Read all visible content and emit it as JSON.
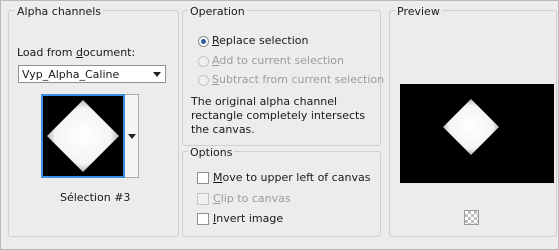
{
  "alpha_channels": {
    "title": "Alpha channels",
    "load_from_label_pre": "Load from ",
    "load_from_label_u": "d",
    "load_from_label_post": "ocument:",
    "document_value": "Vyp_Alpha_Caline",
    "selection_label": "Sélection #3"
  },
  "operation": {
    "title": "Operation",
    "options": [
      {
        "u": "R",
        "rest": "eplace selection",
        "selected": true,
        "enabled": true
      },
      {
        "u": "A",
        "rest": "dd to current selection",
        "selected": false,
        "enabled": false
      },
      {
        "u": "S",
        "rest": "ubtract from current selection",
        "selected": false,
        "enabled": false
      }
    ],
    "description": "The original alpha channel rectangle completely intersects the canvas."
  },
  "options": {
    "title": "Options",
    "items": [
      {
        "u": "M",
        "rest": "ove to upper left of canvas",
        "checked": false,
        "enabled": true
      },
      {
        "u": "C",
        "rest": "lip to canvas",
        "checked": false,
        "enabled": false
      },
      {
        "u": "I",
        "rest": "nvert image",
        "checked": false,
        "enabled": true
      }
    ]
  },
  "preview": {
    "title": "Preview"
  }
}
